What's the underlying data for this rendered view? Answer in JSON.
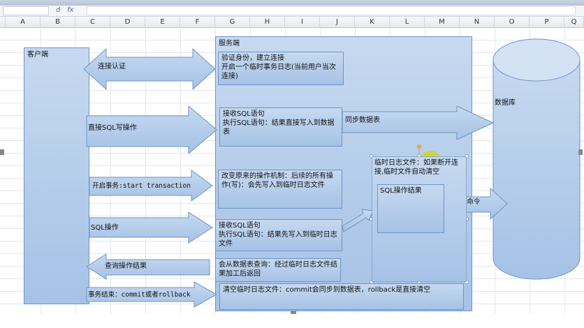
{
  "spreadsheet": {
    "columns": [
      "A",
      "B",
      "C",
      "D",
      "E",
      "F",
      "G",
      "H",
      "I",
      "J",
      "K",
      "L",
      "M",
      "N",
      "O",
      "P",
      "Q"
    ],
    "fx": "fx"
  },
  "colors": {
    "shape_fill_top": "#c6d9f0",
    "shape_fill_bottom": "#a6c2e6",
    "shape_border": "#6d95c4",
    "highlight": "#d8d600"
  },
  "diagram": {
    "client": "客户端",
    "server": "服务端",
    "database": "数据库",
    "arrows": {
      "connect": "连接认证",
      "direct_sql": "直接SQL写操作",
      "start_txn": "开启事务:start transaction",
      "sql_op": "SQL操作",
      "query_result": "查询操作结果",
      "end_txn": "事务结束：commit或者rollback",
      "sync_db": "同步数据表",
      "commit_cmd": "commit命令"
    },
    "server_steps": {
      "verify": "验证身份，建立连接\n开启一个临时事务日志(当前用户当次连接)",
      "receive_direct": "接收SQL语句\n执行SQL语句：结果直接写入到数据表",
      "change_mech": "改变原来的操作机制：后续的所有操作(写)：会先写入到临时日志文件",
      "receive_txn": "接收SQL语句\n执行SQL语句：结果先写入到临时日志文件",
      "query_merge": "会从数据表查询：经过临时日志文件结果加工后返回",
      "clear_log": "清空临时日志文件：commit会同步到数据表，rollback是直接清空"
    },
    "temp_log": "临时日志文件：如果断开连接,临时文件自动清空",
    "sql_result": "SQL操作结果"
  }
}
